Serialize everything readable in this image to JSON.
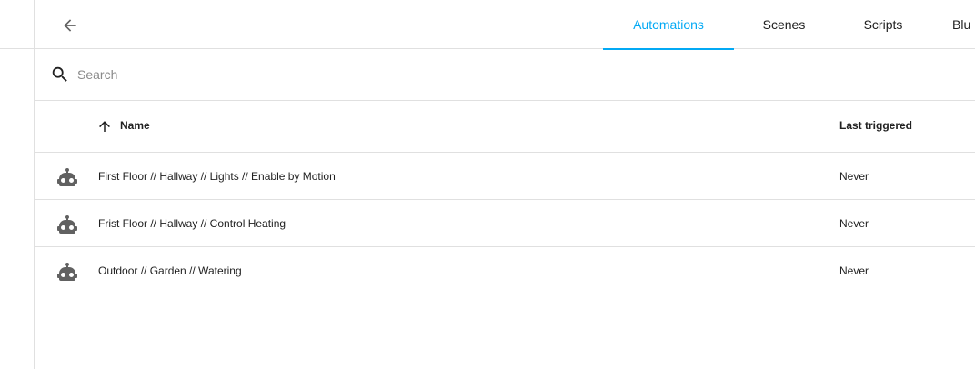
{
  "header": {
    "back_icon": "arrow-left-icon",
    "tabs": [
      {
        "label": "Automations",
        "active": true
      },
      {
        "label": "Scenes",
        "active": false
      },
      {
        "label": "Scripts",
        "active": false
      },
      {
        "label": "Blu",
        "active": false
      }
    ]
  },
  "search": {
    "placeholder": "Search",
    "value": "",
    "icon": "search-icon"
  },
  "table": {
    "columns": {
      "name": "Name",
      "last_triggered": "Last triggered",
      "sort_icon": "arrow-up-icon"
    },
    "rows": [
      {
        "icon": "robot-icon",
        "name": "First Floor // Hallway // Lights // Enable by Motion",
        "last_triggered": "Never"
      },
      {
        "icon": "robot-icon",
        "name": "Frist Floor // Hallway // Control Heating",
        "last_triggered": "Never"
      },
      {
        "icon": "robot-icon",
        "name": "Outdoor // Garden // Watering",
        "last_triggered": "Never"
      }
    ]
  },
  "colors": {
    "accent": "#03a9f4",
    "icon": "#616161",
    "divider": "#e0e0e0"
  }
}
